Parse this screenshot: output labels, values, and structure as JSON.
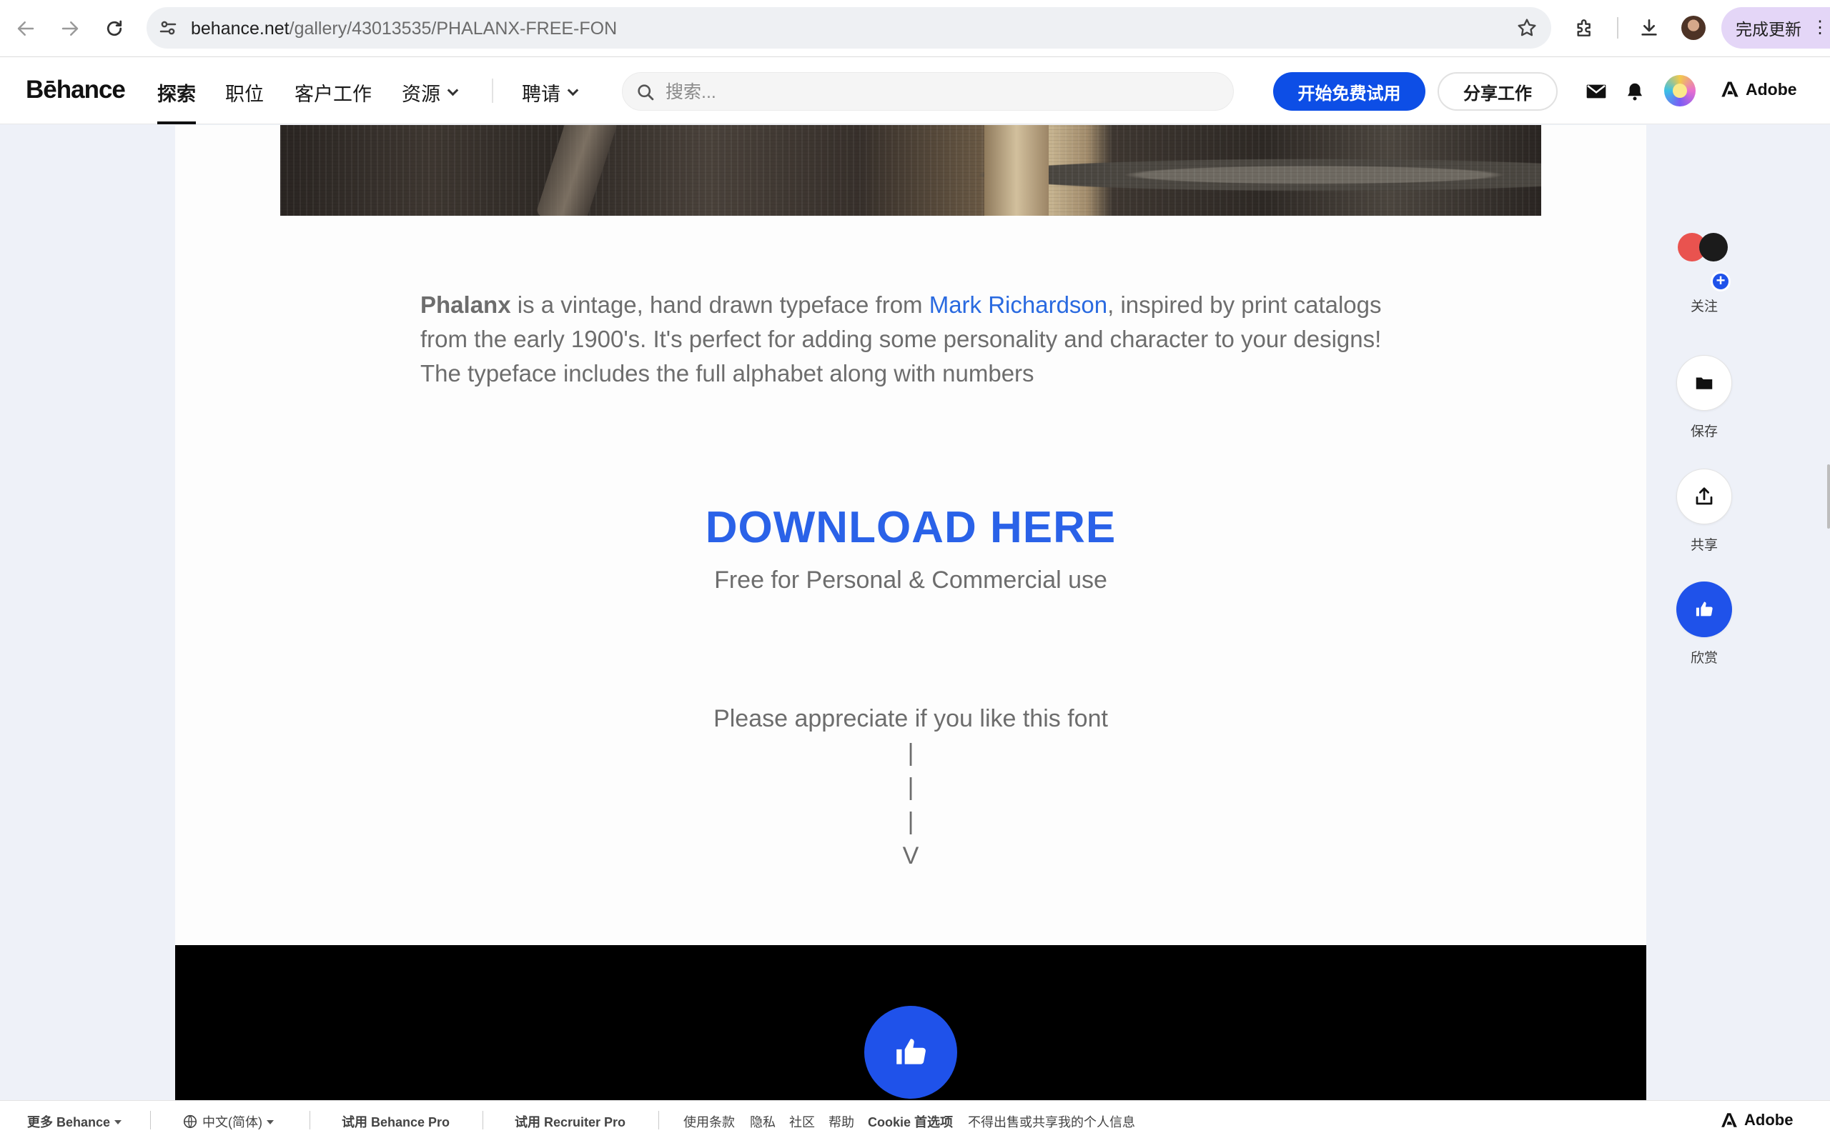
{
  "browser": {
    "url_host": "behance.net",
    "url_path": "/gallery/43013535/PHALANX-FREE-FON",
    "update_label": "完成更新",
    "more_label": "⋮"
  },
  "header": {
    "logo": "Bēhance",
    "nav": [
      {
        "label": "探索"
      },
      {
        "label": "职位"
      },
      {
        "label": "客户工作"
      },
      {
        "label": "资源"
      },
      {
        "label": "聘请"
      }
    ],
    "search_placeholder": "搜索...",
    "trial_button": "开始免费试用",
    "share_button": "分享工作",
    "adobe_label": "Adobe"
  },
  "project": {
    "intro_bold": "Phalanx",
    "intro_text_1": " is a vintage, hand drawn typeface from ",
    "intro_link": "Mark Richardson",
    "intro_text_2": ", inspired by print catalogs from the early 1900's. It's perfect for adding some personality and character to your designs!  The typeface includes the full alphabet along with numbers",
    "download_title": "DOWNLOAD HERE",
    "download_sub": "Free for Personal & Commercial use",
    "appreciate_text": "Please appreciate if you like this font",
    "arrow_lines": [
      "|",
      "|",
      "|",
      "V"
    ]
  },
  "rail": {
    "follow_label": "关注",
    "save_label": "保存",
    "share_label": "共享",
    "appreciate_label": "欣赏"
  },
  "footer": {
    "more_behance": "更多 Behance",
    "language": "中文(简体)",
    "try_pro": "试用 Behance Pro",
    "try_recruiter": "试用 Recruiter Pro",
    "terms": "使用条款",
    "privacy": "隐私",
    "community": "社区",
    "help": "帮助",
    "cookie": "Cookie 首选项",
    "do_not_sell": "不得出售或共享我的个人信息",
    "adobe_label": "Adobe"
  },
  "colors": {
    "accent_blue": "#0d4ee6",
    "link_blue": "#2a6ae0",
    "download_blue": "#2a62e8",
    "appreciate_blue": "#1f52ea"
  }
}
